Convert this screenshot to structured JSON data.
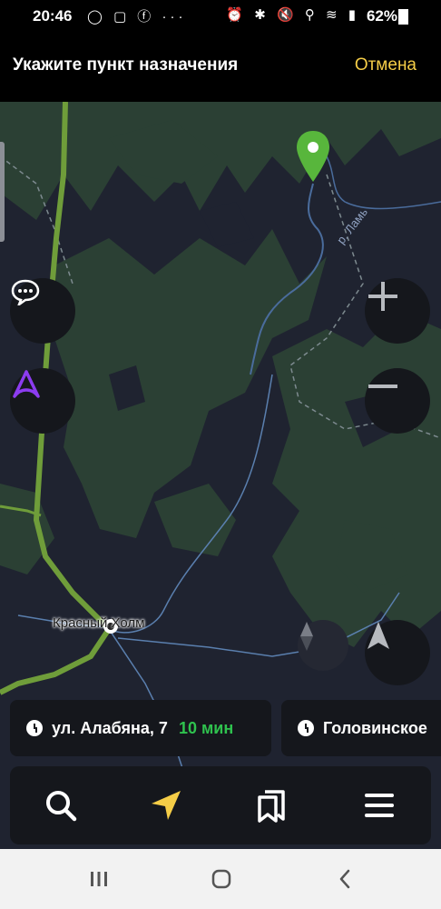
{
  "status_bar": {
    "time": "20:46",
    "left_icons": "◯ ▢ ⓕ  ···",
    "right_icons": "⏰ ✱ 🔇 ⚲ ≋ ▮",
    "battery": "62%"
  },
  "header": {
    "title": "Укажите пункт назначения",
    "cancel_label": "Отмена",
    "cancel_color": "#f5cd47"
  },
  "map": {
    "city_label": "Красный Холм",
    "river_label": "р. Ламь",
    "colors": {
      "forest": "#2b4034",
      "land": "#1f2330",
      "road": "#6f9d3a",
      "water": "#4a6c9c"
    }
  },
  "map_controls": {
    "chat_icon": "chat-bubble-icon",
    "assistant_icon": "alice-assistant-icon",
    "zoom_in_icon": "plus-icon",
    "zoom_out_icon": "minus-icon",
    "compass_icon": "compass-icon",
    "locate_icon": "navigation-arrow-icon"
  },
  "suggestions": [
    {
      "label": "ул. Алабяна, 7",
      "eta": "10 мин"
    },
    {
      "label": "Головинское",
      "eta": ""
    }
  ],
  "bottom_nav": [
    "search-icon",
    "navigate-icon",
    "bookmarks-icon",
    "menu-icon"
  ],
  "accent_color": "#f5cd47",
  "eta_color": "#2fc24e"
}
